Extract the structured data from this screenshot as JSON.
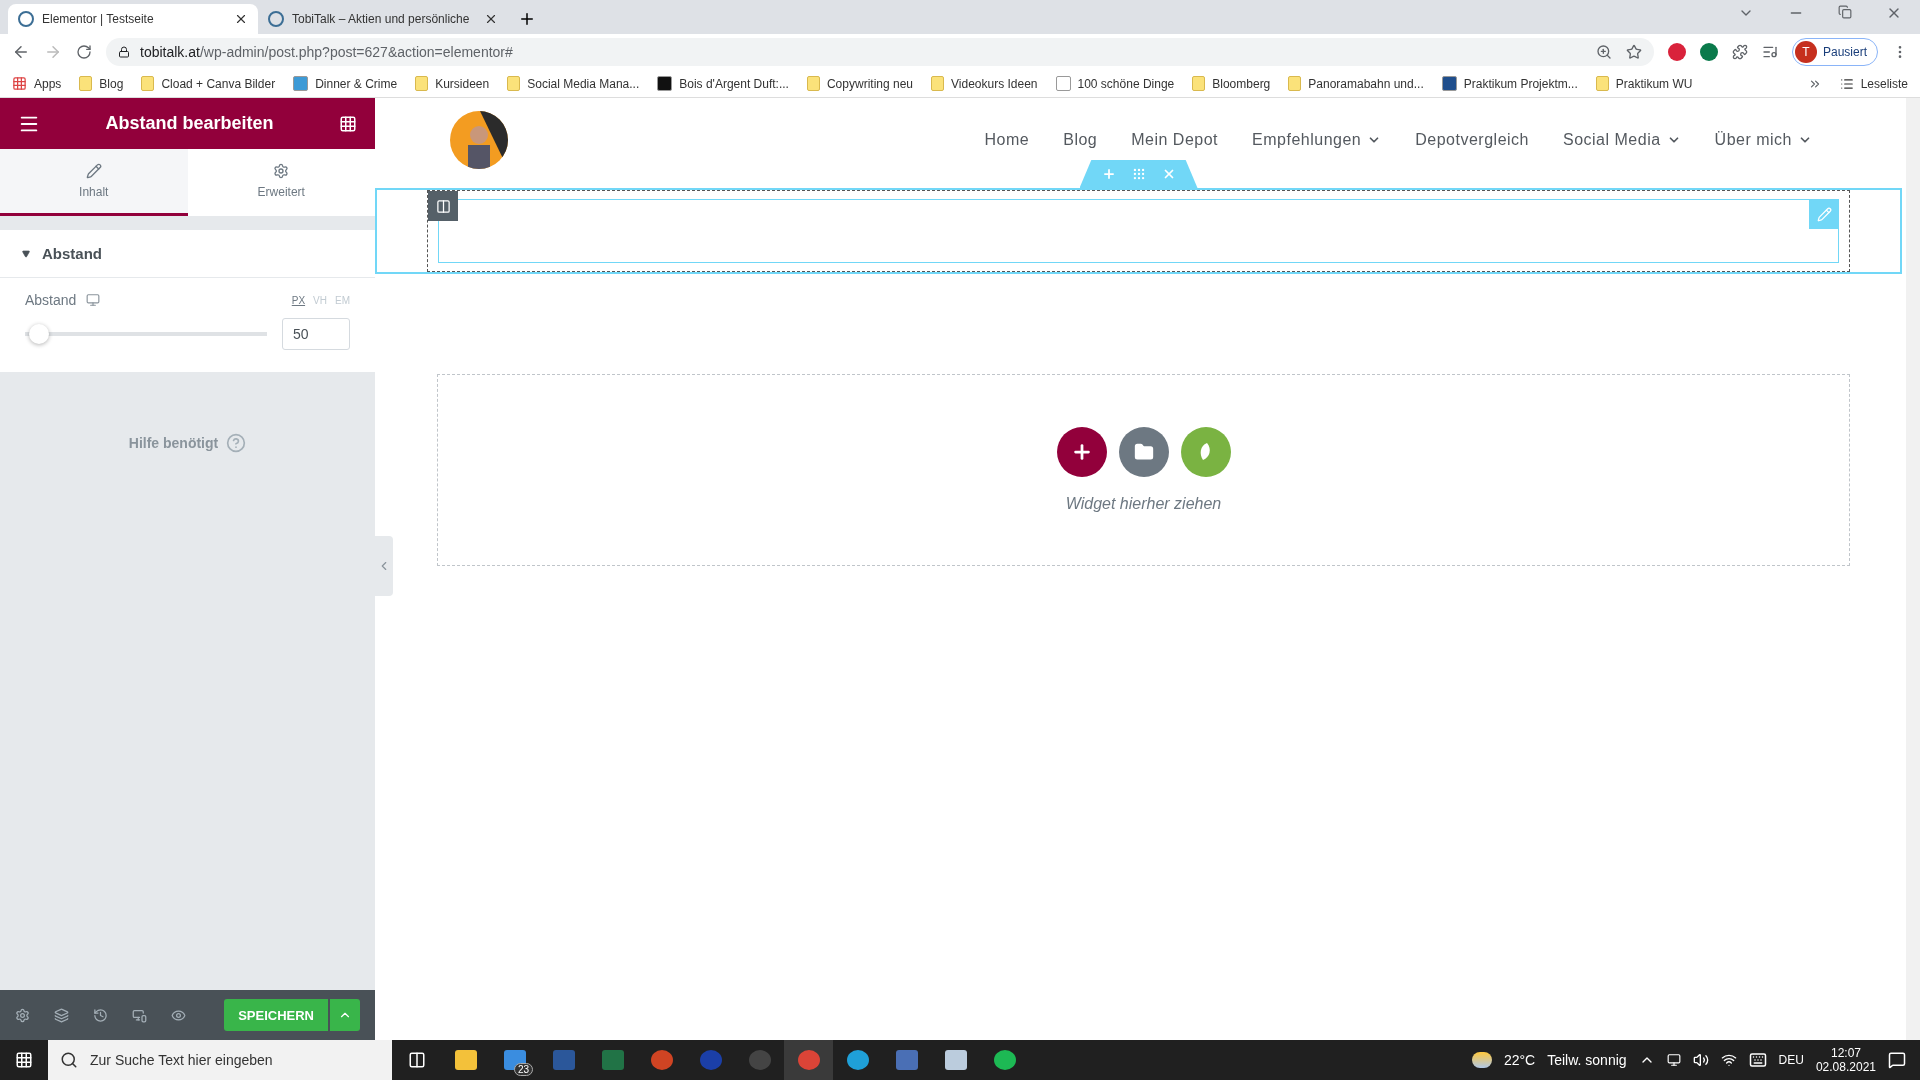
{
  "browser": {
    "tabs": [
      {
        "title": "Elementor | Testseite",
        "selected": true
      },
      {
        "title": "TobiTalk – Aktien und persönliche",
        "selected": false
      }
    ],
    "url_host": "tobitalk.at",
    "url_path": "/wp-admin/post.php?post=627&action=elementor#",
    "profile_initial": "T",
    "profile_label": "Pausiert",
    "bookmarks": [
      {
        "label": "Apps",
        "kind": "apps"
      },
      {
        "label": "Blog",
        "kind": "folder"
      },
      {
        "label": "Cload + Canva Bilder",
        "kind": "folder"
      },
      {
        "label": "Dinner & Crime",
        "kind": "site",
        "color": "#3d9ad6"
      },
      {
        "label": "Kursideen",
        "kind": "folder"
      },
      {
        "label": "Social Media Mana...",
        "kind": "folder"
      },
      {
        "label": "Bois d'Argent Duft:...",
        "kind": "site",
        "color": "#111111"
      },
      {
        "label": "Copywriting neu",
        "kind": "folder"
      },
      {
        "label": "Videokurs Ideen",
        "kind": "folder"
      },
      {
        "label": "100 schöne Dinge",
        "kind": "site",
        "color": "#ffffff"
      },
      {
        "label": "Bloomberg",
        "kind": "folder"
      },
      {
        "label": "Panoramabahn und...",
        "kind": "folder"
      },
      {
        "label": "Praktikum Projektm...",
        "kind": "site",
        "color": "#1f4e8c"
      },
      {
        "label": "Praktikum WU",
        "kind": "folder"
      }
    ],
    "reading_list": "Leseliste"
  },
  "panel": {
    "title": "Abstand bearbeiten",
    "tabs": [
      {
        "label": "Inhalt",
        "kind": "content",
        "selected": true
      },
      {
        "label": "Erweitert",
        "kind": "advanced",
        "selected": false
      }
    ],
    "section": {
      "title": "Abstand",
      "expanded": true
    },
    "control": {
      "label": "Abstand",
      "units": [
        {
          "label": "PX",
          "selected": true
        },
        {
          "label": "VH",
          "selected": false
        },
        {
          "label": "EM",
          "selected": false
        }
      ],
      "level": 0.02,
      "value": "50"
    },
    "help": "Hilfe benötigt",
    "save_button": "SPEICHERN"
  },
  "site": {
    "nav": [
      {
        "label": "Home",
        "dropdown": false
      },
      {
        "label": "Blog",
        "dropdown": false
      },
      {
        "label": "Mein Depot",
        "dropdown": false
      },
      {
        "label": "Empfehlungen",
        "dropdown": true
      },
      {
        "label": "Depotvergleich",
        "dropdown": false
      },
      {
        "label": "Social Media",
        "dropdown": true
      },
      {
        "label": "Über mich",
        "dropdown": true
      }
    ],
    "drop_hint": "Widget hierher ziehen"
  },
  "taskbar": {
    "search_placeholder": "Zur Suche Text hier eingeben",
    "mail_badge": "23",
    "weather": "22°C",
    "weather_text": "Teilw. sonnig",
    "language": "DEU",
    "time": "12:07",
    "date": "02.08.2021"
  }
}
